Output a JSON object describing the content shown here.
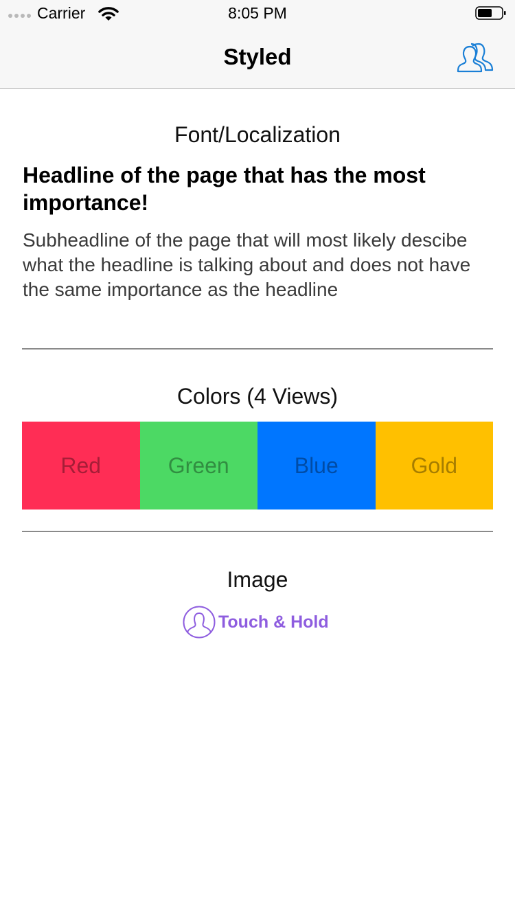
{
  "status_bar": {
    "carrier": "Carrier",
    "time": "8:05 PM",
    "icons": [
      "signal-dots",
      "wifi-icon",
      "battery-icon"
    ]
  },
  "nav_bar": {
    "title": "Styled",
    "right_icon": "users-icon",
    "tint_color": "#1a7fd6"
  },
  "font_section": {
    "title": "Font/Localization",
    "headline": "Headline of the page that has the most importance!",
    "subheadline": "Subheadline of the page that will most likely descibe what the headline is talking about and does not have the same importance as the headline"
  },
  "colors_section": {
    "title": "Colors (4 Views)",
    "swatches": [
      {
        "label": "Red",
        "color": "#ff2d55"
      },
      {
        "label": "Green",
        "color": "#4cd964"
      },
      {
        "label": "Blue",
        "color": "#0076ff"
      },
      {
        "label": "Gold",
        "color": "#ffc000"
      }
    ]
  },
  "image_section": {
    "title": "Image",
    "button_label": "Touch & Hold",
    "icon": "user-circle-icon",
    "accent_color": "#8e5ddf"
  }
}
